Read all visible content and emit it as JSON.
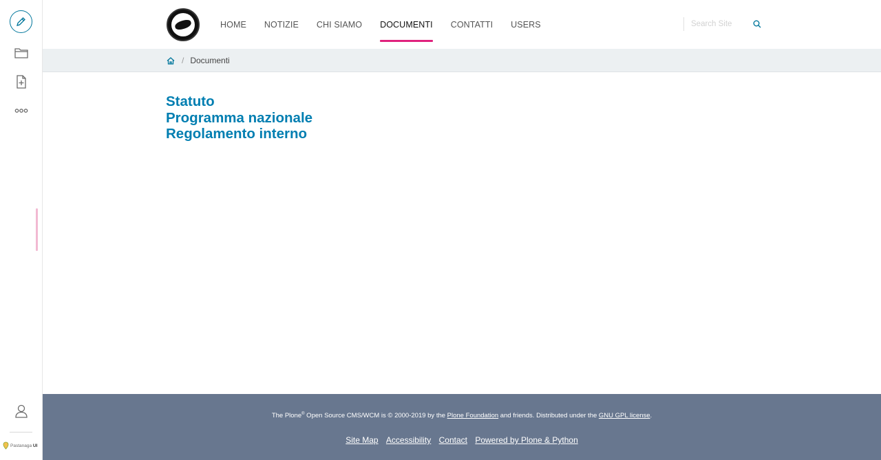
{
  "toolbar": {
    "brand": "Pastanaga UI",
    "brand_plain": "Pastanaga",
    "brand_bold": "UI"
  },
  "header": {
    "nav": [
      {
        "label": "HOME",
        "active": false
      },
      {
        "label": "NOTIZIE",
        "active": false
      },
      {
        "label": "CHI SIAMO",
        "active": false
      },
      {
        "label": "DOCUMENTI",
        "active": true
      },
      {
        "label": "CONTATTI",
        "active": false
      },
      {
        "label": "USERS",
        "active": false
      }
    ],
    "search_placeholder": "Search Site"
  },
  "breadcrumb": {
    "current": "Documenti"
  },
  "main": {
    "links": [
      "Statuto",
      "Programma nazionale",
      "Regolamento interno"
    ]
  },
  "footer": {
    "line_1": "The Plone",
    "registered": "®",
    "line_2": " Open Source CMS/WCM is © 2000-2019 by the ",
    "plone_foundation": "Plone Foundation",
    "line_3": " and friends. Distributed under the ",
    "gpl": "GNU GPL license",
    "line_4": ".",
    "links": [
      "Site Map",
      "Accessibility",
      "Contact",
      "Powered by Plone & Python"
    ]
  },
  "colors": {
    "accent": "#007eb1",
    "nav_active_underline": "#e0227d",
    "footer_bg": "#68778f",
    "breadcrumb_bg": "#ecf0f2"
  }
}
